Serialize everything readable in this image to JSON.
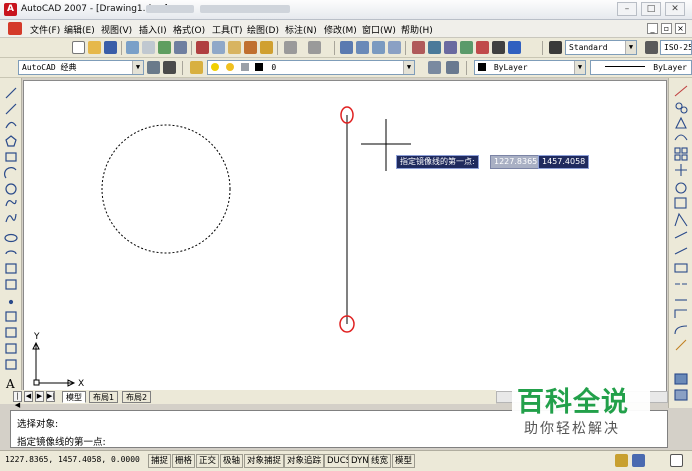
{
  "window": {
    "title": "AutoCAD 2007 - [Drawing1.dwg]",
    "controls": [
      "–",
      "□",
      "✕"
    ],
    "mdi_controls": [
      "_",
      "▫",
      "×"
    ]
  },
  "menu": {
    "items": [
      "文件(F)",
      "编辑(E)",
      "视图(V)",
      "插入(I)",
      "格式(O)",
      "工具(T)",
      "绘图(D)",
      "标注(N)",
      "修改(M)",
      "窗口(W)",
      "帮助(H)"
    ]
  },
  "toolbar": {
    "text_style": "Standard",
    "dim_style": "ISO-25",
    "workspace": "AutoCAD 经典",
    "layer": "0",
    "color": "ByLayer",
    "linetype": "ByLayer"
  },
  "drawing": {
    "tooltip_prompt": "指定镜像线的第一点:",
    "tooltip_x": "1227.8365",
    "tooltip_y": "1457.4058",
    "ucs_x_label": "X",
    "ucs_y_label": "Y",
    "highlight_color": "#e02020"
  },
  "layout_tabs": [
    "模型",
    "布局1",
    "布局2"
  ],
  "tab_nav": [
    "|◀",
    "◀",
    "▶",
    "▶|"
  ],
  "command": {
    "line1": "选择对象:",
    "line2": "指定镜像线的第一点:"
  },
  "status": {
    "coordinates": "1227.8365, 1457.4058, 0.0000",
    "buttons": [
      "捕捉",
      "栅格",
      "正交",
      "极轴",
      "对象捕捉",
      "对象追踪",
      "DUCS",
      "DYN",
      "线宽",
      "模型"
    ]
  },
  "watermark": {
    "brand": "百科全说",
    "slogan": "助你轻松解决"
  }
}
